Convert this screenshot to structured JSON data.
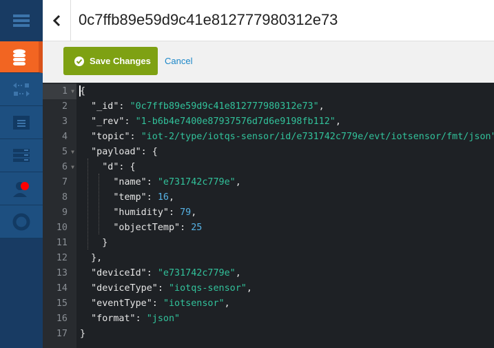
{
  "header": {
    "title": "0c7ffb89e59d9c41e812777980312e73",
    "back_icon": "chevron-left-icon"
  },
  "toolbar": {
    "save_label": "Save Changes",
    "cancel_label": "Cancel"
  },
  "sidebar": {
    "items": [
      {
        "icon": "menu-icon",
        "active": false
      },
      {
        "icon": "database-icon",
        "active": true
      },
      {
        "icon": "replication-icon",
        "active": false
      },
      {
        "icon": "log-icon",
        "active": false
      },
      {
        "icon": "config-icon",
        "active": false
      },
      {
        "icon": "user-icon",
        "active": false,
        "badge": true
      },
      {
        "icon": "help-icon",
        "active": false
      }
    ]
  },
  "colors": {
    "accent": "#f26522",
    "save": "#7ea113",
    "string": "#32c29b",
    "number": "#56b3e6"
  },
  "editor": {
    "lines": [
      {
        "n": "1",
        "fold": true,
        "t": [
          [
            "p",
            "{"
          ]
        ]
      },
      {
        "n": "2",
        "t": [
          [
            "p",
            "  \"_id\": "
          ],
          [
            "s",
            "\"0c7ffb89e59d9c41e812777980312e73\""
          ],
          [
            "p",
            ","
          ]
        ]
      },
      {
        "n": "3",
        "t": [
          [
            "p",
            "  \"_rev\": "
          ],
          [
            "s",
            "\"1-b6b4e7400e87937576d7d6e9198fb112\""
          ],
          [
            "p",
            ","
          ]
        ]
      },
      {
        "n": "4",
        "t": [
          [
            "p",
            "  \"topic\": "
          ],
          [
            "s",
            "\"iot-2/type/iotqs-sensor/id/e731742c779e/evt/iotsensor/fmt/json\""
          ],
          [
            "p",
            ","
          ]
        ]
      },
      {
        "n": "5",
        "fold": true,
        "t": [
          [
            "p",
            "  \"payload\": {"
          ]
        ]
      },
      {
        "n": "6",
        "fold": true,
        "t": [
          [
            "p",
            "    \"d\": {"
          ]
        ]
      },
      {
        "n": "7",
        "t": [
          [
            "p",
            "      \"name\": "
          ],
          [
            "s",
            "\"e731742c779e\""
          ],
          [
            "p",
            ","
          ]
        ]
      },
      {
        "n": "8",
        "t": [
          [
            "p",
            "      \"temp\": "
          ],
          [
            "n",
            "16"
          ],
          [
            "p",
            ","
          ]
        ]
      },
      {
        "n": "9",
        "t": [
          [
            "p",
            "      \"humidity\": "
          ],
          [
            "n",
            "79"
          ],
          [
            "p",
            ","
          ]
        ]
      },
      {
        "n": "10",
        "t": [
          [
            "p",
            "      \"objectTemp\": "
          ],
          [
            "n",
            "25"
          ]
        ]
      },
      {
        "n": "11",
        "t": [
          [
            "p",
            "    }"
          ]
        ]
      },
      {
        "n": "12",
        "t": [
          [
            "p",
            "  },"
          ]
        ]
      },
      {
        "n": "13",
        "t": [
          [
            "p",
            "  \"deviceId\": "
          ],
          [
            "s",
            "\"e731742c779e\""
          ],
          [
            "p",
            ","
          ]
        ]
      },
      {
        "n": "14",
        "t": [
          [
            "p",
            "  \"deviceType\": "
          ],
          [
            "s",
            "\"iotqs-sensor\""
          ],
          [
            "p",
            ","
          ]
        ]
      },
      {
        "n": "15",
        "t": [
          [
            "p",
            "  \"eventType\": "
          ],
          [
            "s",
            "\"iotsensor\""
          ],
          [
            "p",
            ","
          ]
        ]
      },
      {
        "n": "16",
        "t": [
          [
            "p",
            "  \"format\": "
          ],
          [
            "s",
            "\"json\""
          ]
        ]
      },
      {
        "n": "17",
        "t": [
          [
            "p",
            "}"
          ]
        ]
      }
    ]
  }
}
